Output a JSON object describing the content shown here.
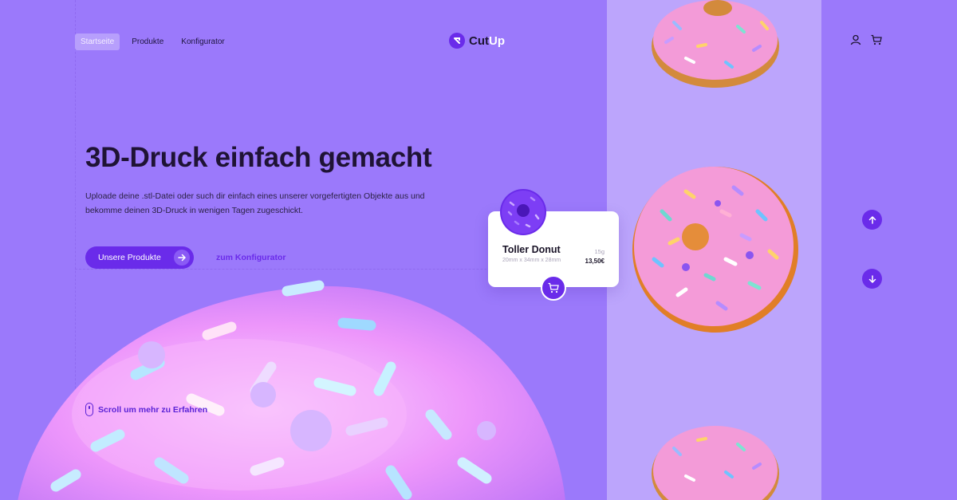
{
  "nav": {
    "items": [
      {
        "label": "Startseite",
        "active": true
      },
      {
        "label": "Produkte",
        "active": false
      },
      {
        "label": "Konfigurator",
        "active": false
      }
    ]
  },
  "brand": {
    "name_part1": "Cut",
    "name_part2": "Up"
  },
  "header_icons": [
    "user-icon",
    "cart-icon"
  ],
  "hero": {
    "title": "3D-Druck einfach gemacht",
    "text": "Uploade deine .stl-Datei oder such dir einfach eines unserer vorgefertigten Objekte aus und bekomme deinen 3D-Druck in wenigen Tagen zugeschickt.",
    "primary_button": "Unsere Produkte",
    "secondary_link": "zum Konfigurator",
    "scroll_hint": "Scroll um mehr zu Erfahren"
  },
  "product_card": {
    "title": "Toller Donut",
    "dimensions": "20mm x 34mm x 28mm",
    "weight": "15g",
    "price": "13,50€"
  },
  "colors": {
    "background": "#9b79fb",
    "accent": "#6a2bea",
    "side_column": "#bca5fc",
    "card": "#ffffff"
  }
}
